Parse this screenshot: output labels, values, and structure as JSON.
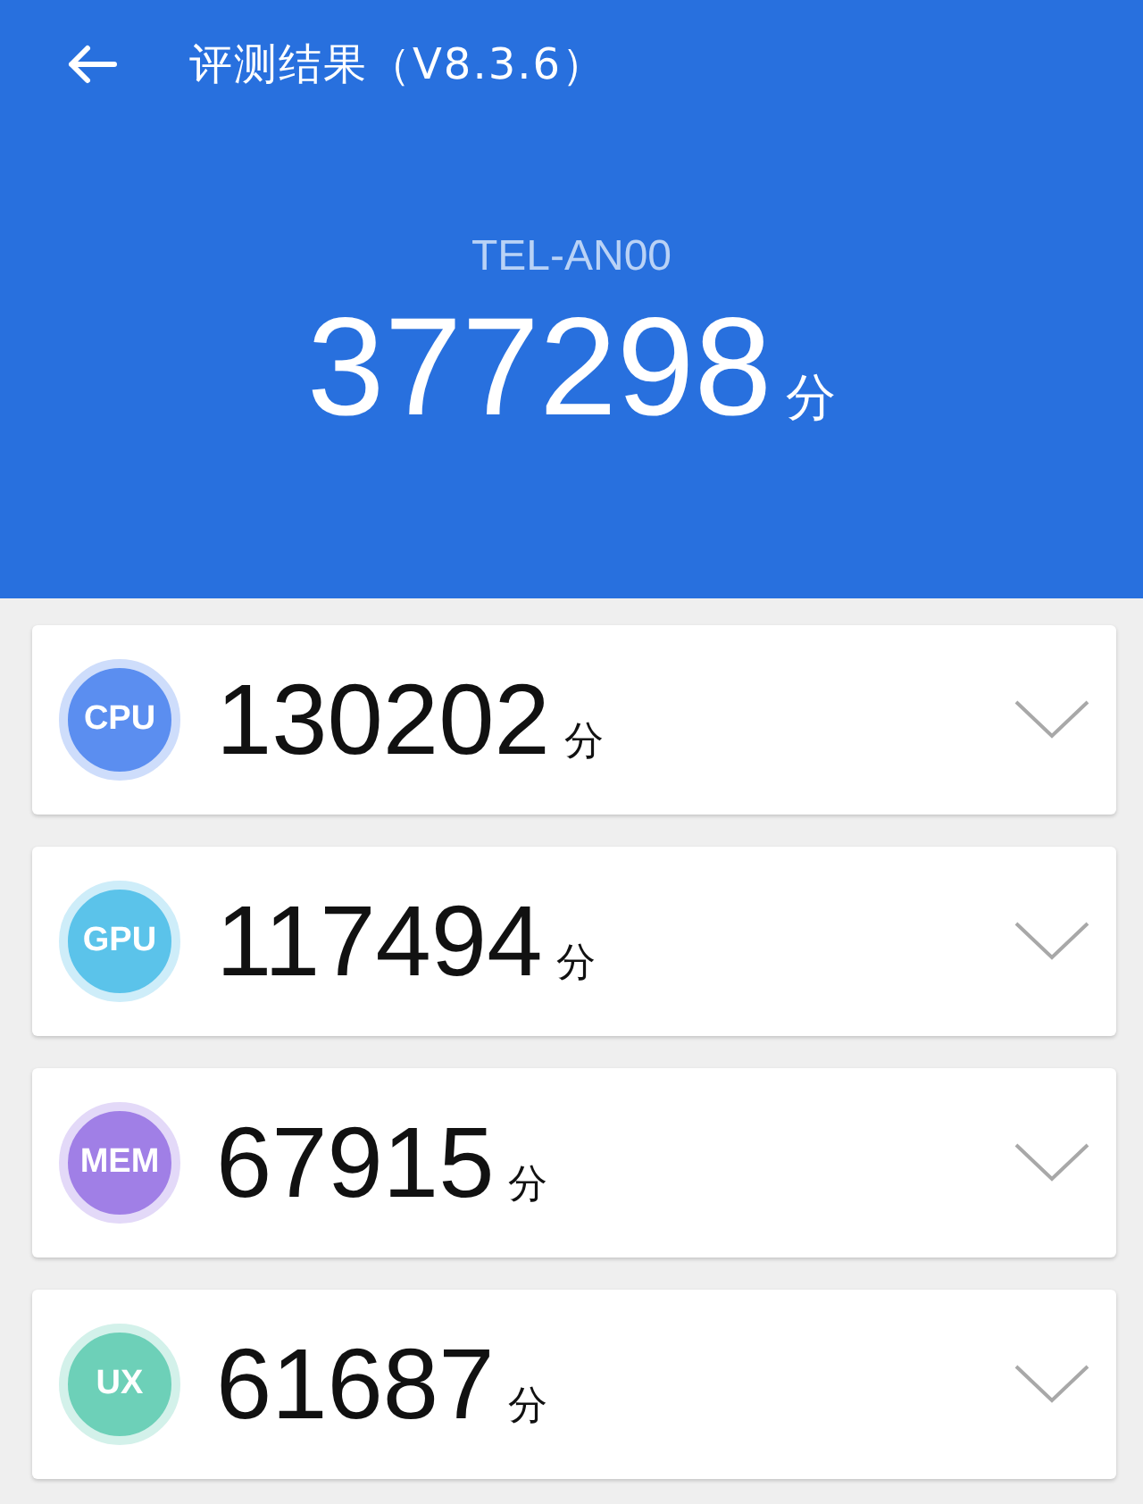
{
  "header": {
    "title": "评测结果（V8.3.6）",
    "device": "TEL-AN00",
    "total_score": "377298",
    "total_unit": "分"
  },
  "results": [
    {
      "label": "CPU",
      "color": "#5b8ef0",
      "score": "130202",
      "unit": "分"
    },
    {
      "label": "GPU",
      "color": "#5bc3ea",
      "score": "117494",
      "unit": "分"
    },
    {
      "label": "MEM",
      "color": "#a07fe6",
      "score": "67915",
      "unit": "分"
    },
    {
      "label": "UX",
      "color": "#6dd0b8",
      "score": "61687",
      "unit": "分"
    }
  ]
}
